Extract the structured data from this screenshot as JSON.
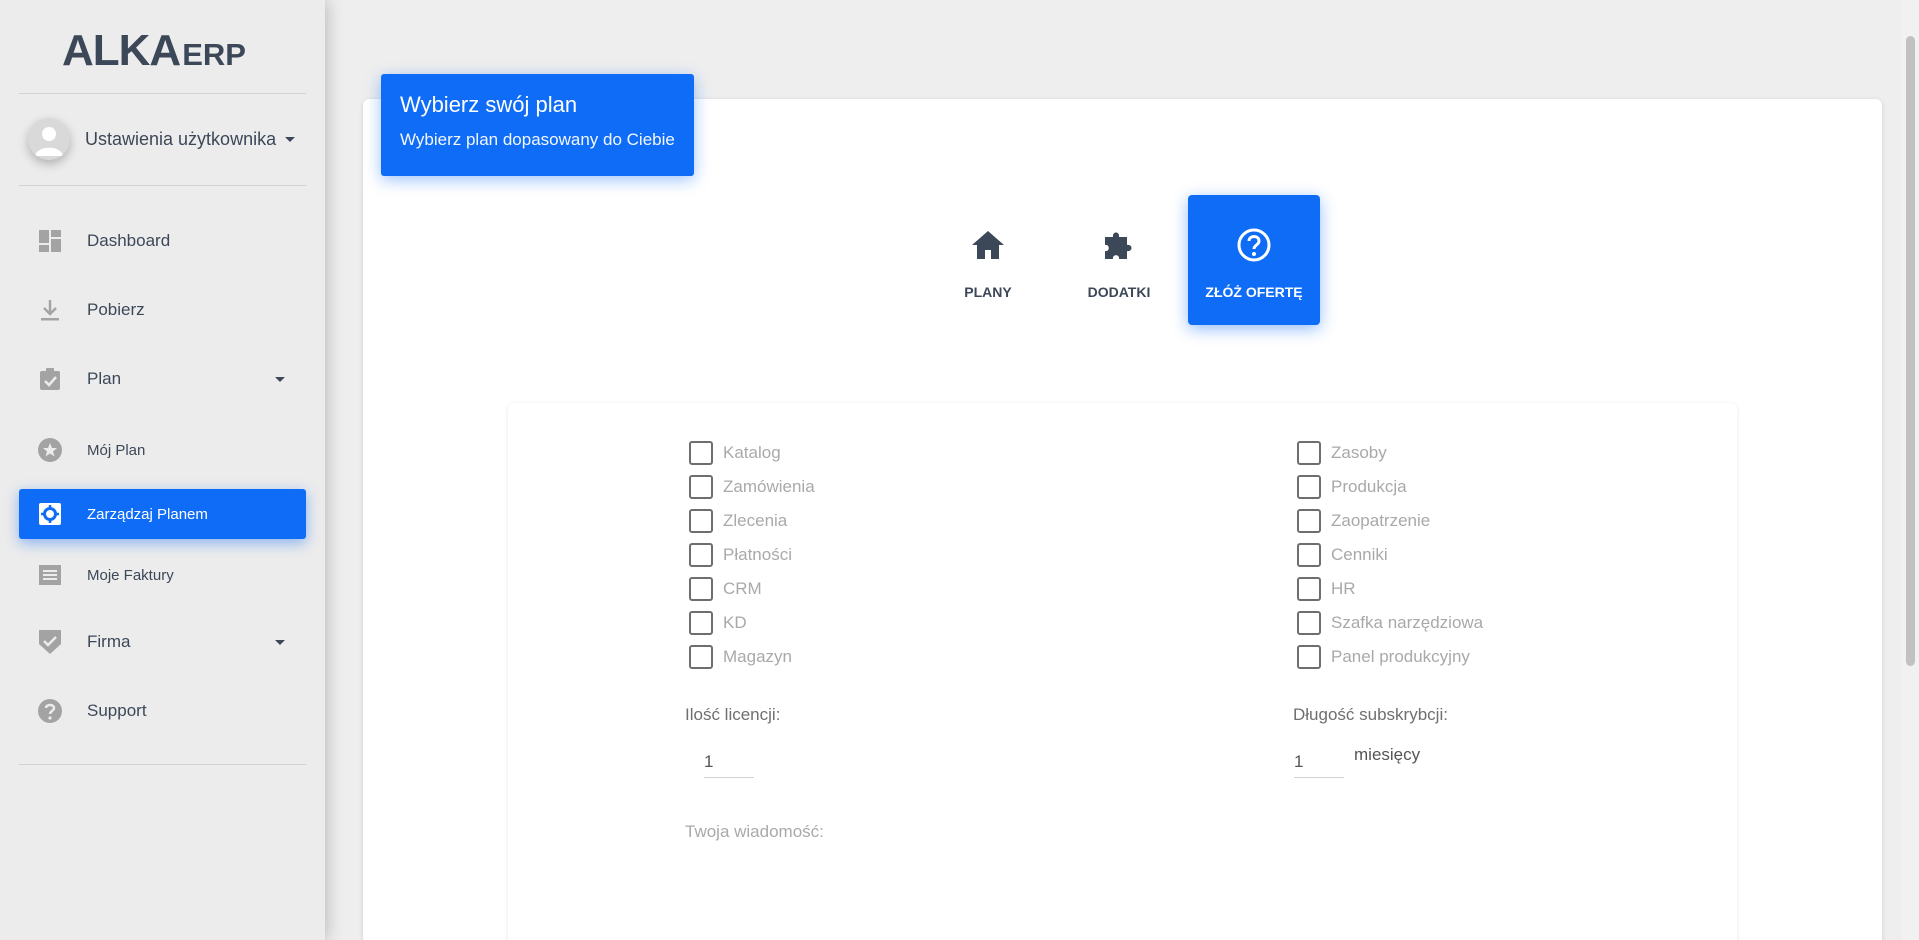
{
  "brand": {
    "logo_main": "ALKA",
    "logo_sub": "ERP"
  },
  "user": {
    "label": "Ustawienia użytkownika"
  },
  "nav": {
    "dashboard": "Dashboard",
    "pobierz": "Pobierz",
    "plan": "Plan",
    "moj_plan": "Mój Plan",
    "zarzadzaj": "Zarządzaj Planem",
    "faktury": "Moje Faktury",
    "firma": "Firma",
    "support": "Support"
  },
  "header": {
    "title": "Wybierz swój plan",
    "subtitle": "Wybierz plan dopasowany do Ciebie"
  },
  "tabs": {
    "plany": "PLANY",
    "dodatki": "DODATKI",
    "oferta": "ZŁÓŻ OFERTĘ"
  },
  "modules_left": [
    "Katalog",
    "Zamówienia",
    "Zlecenia",
    "Płatności",
    "CRM",
    "KD",
    "Magazyn"
  ],
  "modules_right": [
    "Zasoby",
    "Produkcja",
    "Zaopatrzenie",
    "Cenniki",
    "HR",
    "Szafka narzędziowa",
    "Panel produkcyjny"
  ],
  "form": {
    "licenses_label": "Ilość licencji:",
    "licenses_value": "1",
    "subscription_label": "Długość subskrybcji:",
    "subscription_value": "1",
    "subscription_unit": "miesięcy",
    "message_label": "Twoja wiadomość:"
  },
  "colors": {
    "accent": "#0f6cf6",
    "text": "#3c4858",
    "muted": "#a9a9a9"
  }
}
